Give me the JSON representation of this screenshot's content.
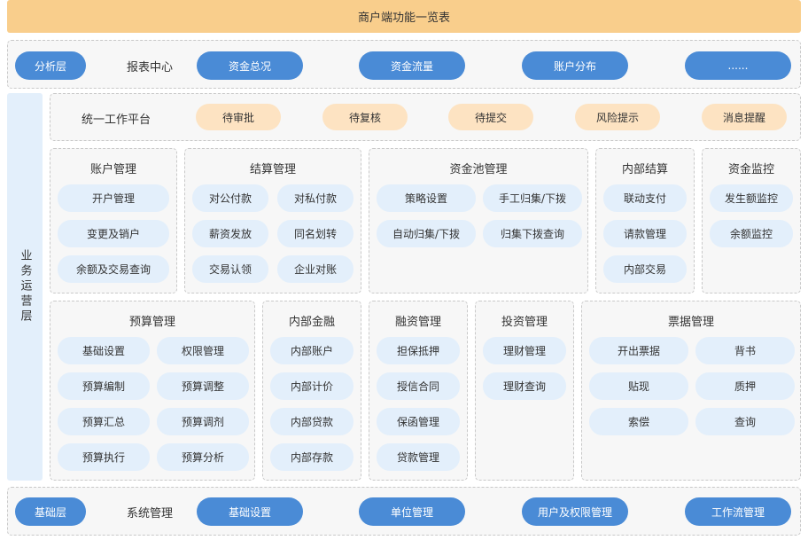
{
  "title": "商户端功能一览表",
  "report_row": {
    "layer": "分析层",
    "label": "报表中心",
    "items": [
      "资金总况",
      "资金流量",
      "账户分布",
      "......"
    ]
  },
  "side_label": "业务运营层",
  "workbench": {
    "label": "统一工作平台",
    "items": [
      "待审批",
      "待复核",
      "待提交",
      "风险提示",
      "消息提醒"
    ]
  },
  "modules": {
    "account": {
      "title": "账户管理",
      "items": [
        "开户管理",
        "变更及销户",
        "余额及交易查询"
      ]
    },
    "settlement": {
      "title": "结算管理",
      "items": [
        "对公付款",
        "对私付款",
        "薪资发放",
        "同名划转",
        "交易认领",
        "企业对账"
      ]
    },
    "cashpool": {
      "title": "资金池管理",
      "items": [
        "策略设置",
        "手工归集/下拨",
        "自动归集/下拨",
        "归集下拨查询"
      ]
    },
    "internal_settle": {
      "title": "内部结算",
      "items": [
        "联动支付",
        "请款管理",
        "内部交易"
      ]
    },
    "monitor": {
      "title": "资金监控",
      "items": [
        "发生额监控",
        "余额监控"
      ]
    },
    "budget": {
      "title": "预算管理",
      "items": [
        "基础设置",
        "权限管理",
        "预算编制",
        "预算调整",
        "预算汇总",
        "预算调剂",
        "预算执行",
        "预算分析"
      ]
    },
    "internal_finance": {
      "title": "内部金融",
      "items": [
        "内部账户",
        "内部计价",
        "内部贷款",
        "内部存款"
      ]
    },
    "financing": {
      "title": "融资管理",
      "items": [
        "担保抵押",
        "授信合同",
        "保函管理",
        "贷款管理"
      ]
    },
    "investment": {
      "title": "投资管理",
      "items": [
        "理财管理",
        "理财查询"
      ]
    },
    "bills": {
      "title": "票据管理",
      "items": [
        "开出票据",
        "背书",
        "贴现",
        "质押",
        "索偿",
        "查询"
      ]
    }
  },
  "system_row": {
    "layer": "基础层",
    "label": "系统管理",
    "items": [
      "基础设置",
      "单位管理",
      "用户及权限管理",
      "工作流管理"
    ]
  }
}
